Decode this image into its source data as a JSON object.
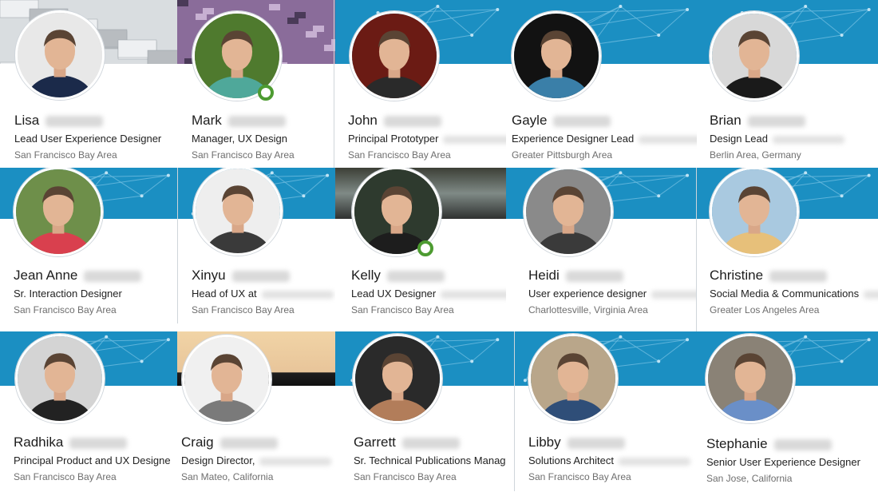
{
  "colors": {
    "banner_blue": "#1b8fc2",
    "banner_line": "#6fbde0",
    "online_green": "#4d9b31"
  },
  "people": [
    {
      "first_name": "Lisa",
      "headline": "Lead User Experience Designer",
      "headline_clipped": false,
      "location": "San Francisco Bay Area",
      "online": false,
      "banner": "screens-photo",
      "avatar_bg": "#e8e8e8",
      "avatar_shirt": "#1b2a4a"
    },
    {
      "first_name": "Mark",
      "headline": "Manager, UX Design",
      "headline_clipped": false,
      "location": "San Francisco Bay Area",
      "online": true,
      "banner": "circuit-photo",
      "avatar_bg": "#4f7a2e",
      "avatar_shirt": "#4fa89a"
    },
    {
      "first_name": "John",
      "headline": "Principal Prototyper",
      "headline_clipped": true,
      "location": "San Francisco Bay Area",
      "online": false,
      "banner": "blue-network",
      "avatar_bg": "#6b1b14",
      "avatar_shirt": "#2a2a2a"
    },
    {
      "first_name": "Gayle",
      "headline": "Experience Designer Lead",
      "headline_clipped": true,
      "location": "Greater Pittsburgh Area",
      "online": false,
      "banner": "blue-network",
      "avatar_bg": "#121212",
      "avatar_shirt": "#3a7fa8"
    },
    {
      "first_name": "Brian",
      "headline": "Design Lead",
      "headline_clipped": true,
      "location": "Berlin Area, Germany",
      "online": false,
      "banner": "blue-network",
      "avatar_bg": "#d8d8d8",
      "avatar_shirt": "#1a1a1a"
    },
    {
      "first_name": "Jean Anne",
      "headline": "Sr. Interaction Designer",
      "headline_clipped": false,
      "location": "San Francisco Bay Area",
      "online": false,
      "banner": "blue-network",
      "avatar_bg": "#6e8f4a",
      "avatar_shirt": "#d9404e"
    },
    {
      "first_name": "Xinyu",
      "headline": "Head of UX at",
      "headline_clipped": true,
      "location": "San Francisco Bay Area",
      "online": false,
      "banner": "blue-network",
      "avatar_bg": "#eeeeee",
      "avatar_shirt": "#3a3a3a"
    },
    {
      "first_name": "Kelly",
      "headline": "Lead UX Designer",
      "headline_clipped": true,
      "location": "San Francisco Bay Area",
      "online": true,
      "banner": "water-photo",
      "avatar_bg": "#2e3a2e",
      "avatar_shirt": "#1d1d1d"
    },
    {
      "first_name": "Heidi",
      "headline": "User experience designer",
      "headline_clipped": true,
      "location": "Charlottesville, Virginia Area",
      "online": false,
      "banner": "blue-network",
      "avatar_bg": "#8a8a8a",
      "avatar_shirt": "#3a3a3a"
    },
    {
      "first_name": "Christine",
      "headline": "Social Media & Communications",
      "headline_clipped": true,
      "location": "Greater Los Angeles Area",
      "online": false,
      "banner": "blue-network",
      "avatar_bg": "#a9c9e0",
      "avatar_shirt": "#e7c07a"
    },
    {
      "first_name": "Radhika",
      "headline": "Principal Product and UX Designe",
      "headline_clipped": false,
      "location": "San Francisco Bay Area",
      "online": false,
      "banner": "blue-network",
      "avatar_bg": "#d4d4d4",
      "avatar_shirt": "#222222"
    },
    {
      "first_name": "Craig",
      "headline": "Design Director,",
      "headline_clipped": true,
      "location": "San Mateo, California",
      "online": false,
      "banner": "sunset-photo",
      "avatar_bg": "#f0f0f0",
      "avatar_shirt": "#7a7a7a"
    },
    {
      "first_name": "Garrett",
      "headline": "Sr. Technical Publications Manager",
      "headline_clipped": false,
      "location": "San Francisco Bay Area",
      "online": false,
      "banner": "blue-network",
      "avatar_bg": "#2a2a2a",
      "avatar_shirt": "#b27d5a"
    },
    {
      "first_name": "Libby",
      "headline": "Solutions Architect",
      "headline_clipped": true,
      "location": "San Francisco Bay Area",
      "online": false,
      "banner": "blue-network",
      "avatar_bg": "#b9a68a",
      "avatar_shirt": "#2f4e78"
    },
    {
      "first_name": "Stephanie",
      "headline": "Senior User Experience Designer",
      "headline_clipped": false,
      "location": "San Jose, California",
      "online": false,
      "banner": "blue-network",
      "avatar_bg": "#8a8276",
      "avatar_shirt": "#6a8fc8"
    }
  ]
}
